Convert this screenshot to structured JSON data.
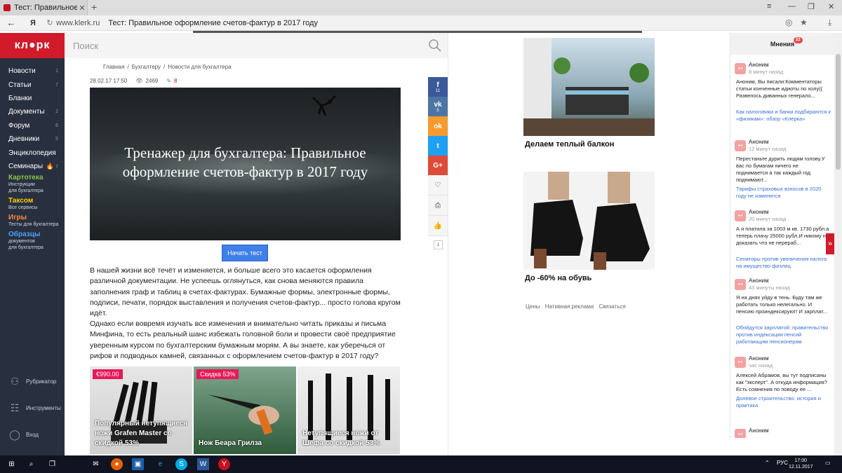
{
  "browser": {
    "tab_title": "Тест: Правильное оформ...",
    "url_domain": "www.klerk.ru",
    "page_title": "Тест: Правильное оформление счетов-фактур в 2017 году",
    "yandex_label": "Я",
    "icons": [
      "back-icon",
      "yandex-icon",
      "reload-icon",
      "star-icon",
      "download-icon",
      "close-icon",
      "plus-icon"
    ]
  },
  "logo": "кл●рк",
  "search": {
    "placeholder": "Поиск"
  },
  "sidebar": {
    "items": [
      {
        "label": "Новости",
        "count": "1"
      },
      {
        "label": "Статьи",
        "count": "7"
      },
      {
        "label": "Бланки",
        "count": ""
      },
      {
        "label": "Документы",
        "count": "2"
      },
      {
        "label": "Форум",
        "count": "6"
      },
      {
        "label": "Дневники",
        "count": "5"
      },
      {
        "label": "Энциклопедия",
        "count": ""
      },
      {
        "label": "Семинары",
        "count": "7"
      }
    ],
    "promos": [
      {
        "title": "Картотека",
        "sub": "Инструкции\nдля бухгалтера",
        "color": "#8bc34a"
      },
      {
        "title": "Таксом",
        "sub": "Все сервисы",
        "color": "#f5d000"
      },
      {
        "title": "Игры",
        "sub": "Тесты для бухгалтера",
        "color": "#ff8a3d"
      },
      {
        "title": "Образцы",
        "sub": "документов\nдля бухгалтера",
        "color": "#4aa3ff"
      }
    ],
    "bottom": [
      {
        "label": "Рубрикатор"
      },
      {
        "label": "Инструменты"
      },
      {
        "label": "Вход"
      }
    ]
  },
  "breadcrumb": [
    "Главная",
    "/",
    "Бухгалтеру",
    "/",
    "Новости для бухгалтера"
  ],
  "meta": {
    "date": "28.02.17 17:50",
    "views": "2469",
    "comments": "8"
  },
  "hero": {
    "title": "Тренажер для бухгалтера: Правильное оформление счетов-фактур в 2017 году"
  },
  "start_button": "Начать тест",
  "paragraphs": [
    "В нашей жизни всё течёт и изменяется, и больше всего это касается оформления различной документации. Не успеешь оглянуться, как снова меняются правила заполнения граф и таблиц в счетах-фактурах. Бумажные формы, электронные формы, подписи, печати, порядок выставления и получения счетов-фактур... просто голова кругом идёт.",
    "Однако если вовремя изучать все изменения и внимательно читать приказы и письма Минфина, то есть реальный шанс избежать головной боли и провести своё предприятие уверенным курсом по бухгалтерским бумажным морям. А вы знаете, как уберечься от рифов и подводных камней, связанных с оформлением счетов-фактур в 2017 году?"
  ],
  "ad_cards": [
    {
      "badge": "€990.00",
      "text": "Популярный нетупящиеся ножи Grafen Master со скидкой 53%"
    },
    {
      "badge": "Скидка 53%",
      "text": "Нож Беара Грилза"
    },
    {
      "badge": "",
      "text": "Нетупящиеся ножи от Шефа со скидкой 53%"
    }
  ],
  "share": {
    "facebook": {
      "icon": "f",
      "count": "11"
    },
    "vk": {
      "icon": "vk",
      "count": "5"
    },
    "ok": {
      "icon": "ok"
    },
    "twitter": {
      "icon": "t"
    },
    "gplus": {
      "icon": "G+"
    },
    "counter": "1"
  },
  "ads": {
    "items": [
      {
        "title": "Делаем теплый балкон"
      },
      {
        "title": "До -60% на обувь"
      }
    ],
    "links": [
      "Цены",
      "Нативная реклама",
      "Связаться"
    ]
  },
  "opinions": {
    "title": "Мнения",
    "badge": "22",
    "items": [
      {
        "name": "Аноним",
        "time": "8 минут назад",
        "text": "Аноним, Вы писали:Комментаторы статьи конченные идиоты по холу(( Развелось диванных генерало...",
        "link": "Как налоговики и банки подбираются к «физикам»: обзор «Клерка»"
      },
      {
        "name": "Аноним",
        "time": "12 минут назад",
        "text": "Перестаньте дурить людям голову.У вас по бумагам ничего не поднимается а так каждый год поднимают...",
        "link": "Тарифы страховых взносов в 2020 году не изменятся"
      },
      {
        "name": "Аноним",
        "time": "20 минут назад",
        "text": "А я платила за 1003 м кв. 1730 рубл.а теперь плачу 25000 рубл.И никому не доказать что не перераб...",
        "link": "Сенаторы против увеличения налога на имущество физлиц"
      },
      {
        "name": "Аноним",
        "time": "43 минуты назад",
        "text": "Я на днях уйду в тень. Буду там же работать только нелегально. И пенсию проиндексируют! И зарплат...",
        "link": "Обойдутся зарплатой: правительство против индексации пенсий работающим пенсионерам"
      },
      {
        "name": "Аноним",
        "time": "час назад",
        "text": "Алексей Абрамов, вы тут подписаны как \"эксперт\". А откуда информация? Есть сомнения по поводу ее ...",
        "link": "Долевое строительство: история и практика"
      },
      {
        "name": "Аноним",
        "time": "",
        "text": "",
        "link": ""
      }
    ]
  },
  "taskbar": {
    "lang": "РУС",
    "time": "17:00",
    "date": "12.11.2017"
  }
}
